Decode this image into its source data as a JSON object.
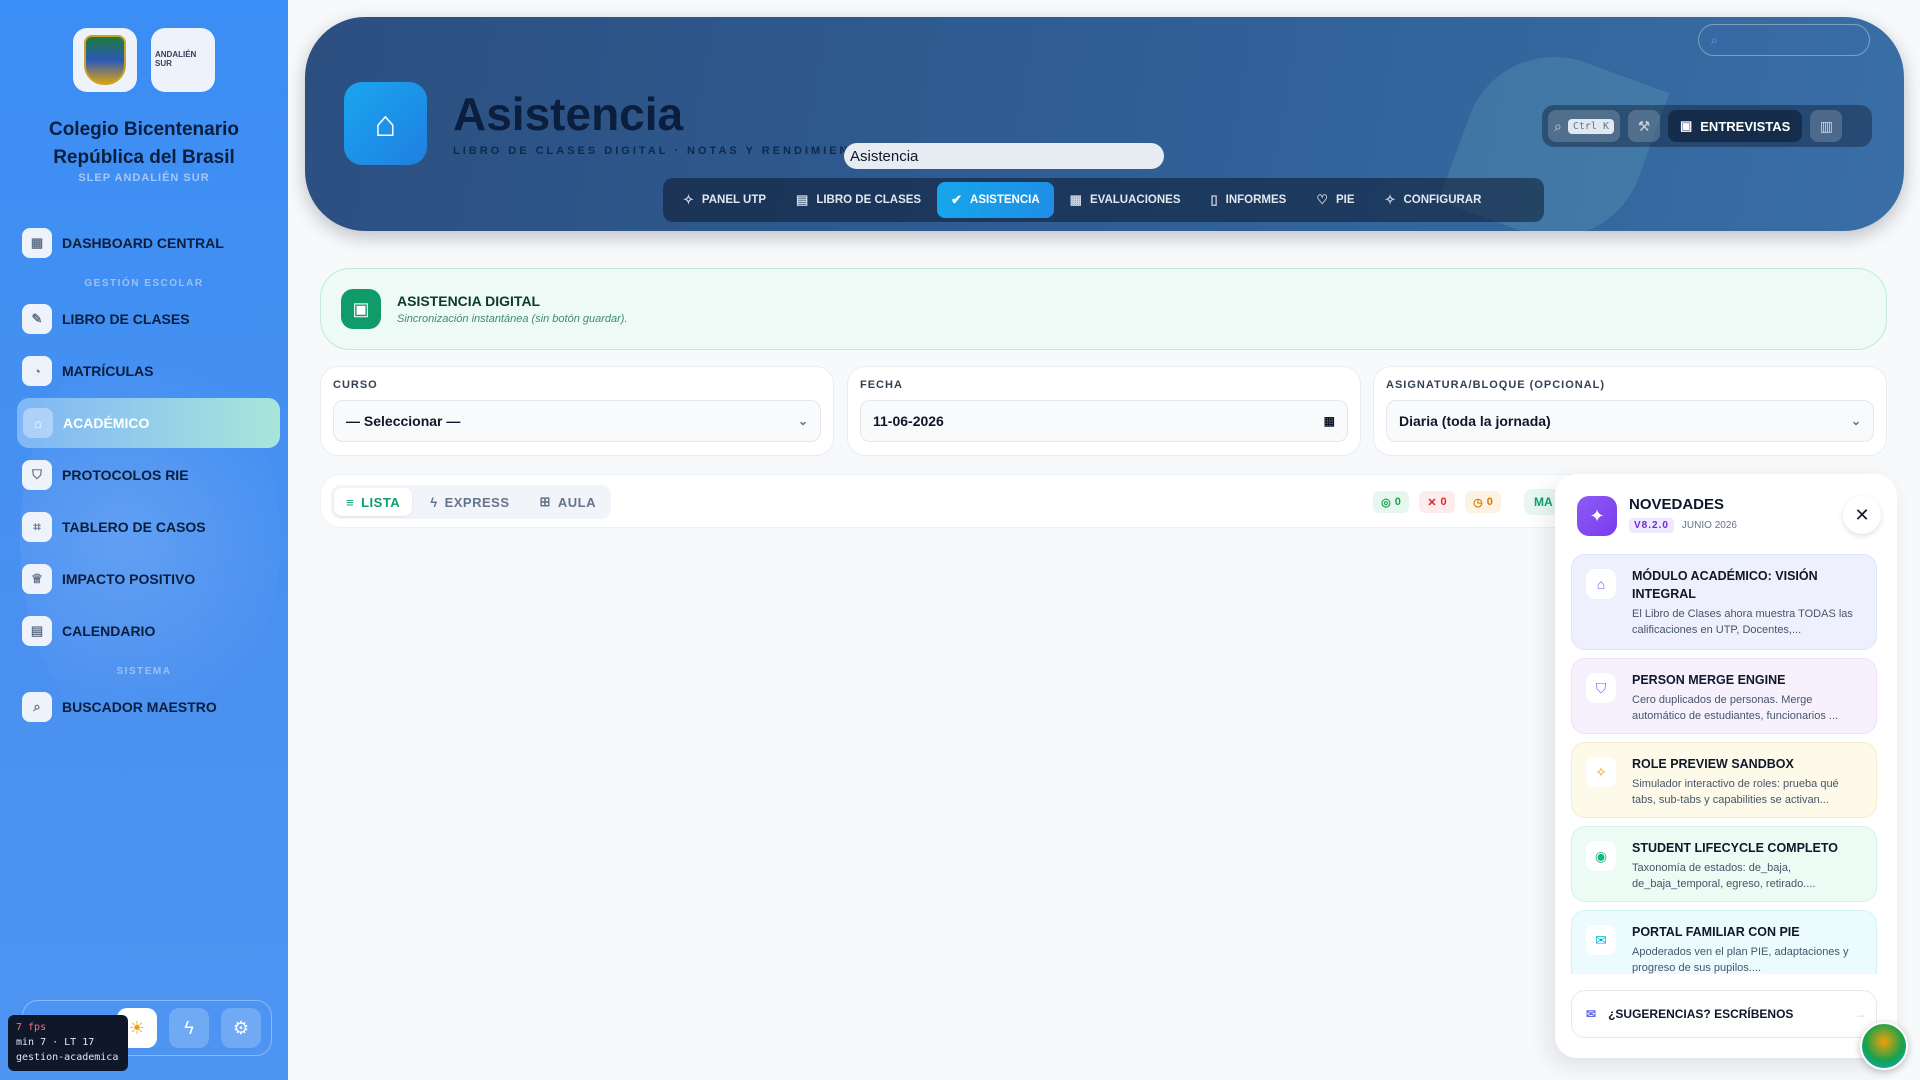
{
  "sidebar": {
    "logo_right_text": "ANDALIÉN SUR",
    "school_name": "Colegio Bicentenario República del Brasil",
    "school_sub": "SLEP ANDALIÉN SUR",
    "dashboard": "DASHBOARD CENTRAL",
    "section_escolar": "GESTIÓN ESCOLAR",
    "items": [
      {
        "label": "LIBRO DE CLASES",
        "icon": "pencil-icon"
      },
      {
        "label": "MATRÍCULAS",
        "icon": "user-icon"
      },
      {
        "label": "ACADÉMICO",
        "icon": "graduation-cap-icon",
        "active": true
      },
      {
        "label": "PROTOCOLOS RIE",
        "icon": "shield-icon"
      },
      {
        "label": "TABLERO DE CASOS",
        "icon": "scan-face-icon"
      },
      {
        "label": "IMPACTO POSITIVO",
        "icon": "trophy-icon"
      },
      {
        "label": "CALENDARIO",
        "icon": "calendar-icon"
      }
    ],
    "section_sistema": "SISTEMA",
    "buscador": "BUSCADOR MAESTRO"
  },
  "fps_overlay": {
    "fps": "7 fps",
    "line2": "min 7 · LT 17",
    "line3": "gestion-academica"
  },
  "header": {
    "title": "Asistencia",
    "subtitle": "LIBRO DE CLASES DIGITAL · NOTAS Y RENDIMIENTO",
    "tooltip_value": "Asistencia",
    "search_kbd": "Ctrl K",
    "entrevistas_label": "ENTREVISTAS",
    "tabs": [
      {
        "label": "PANEL UTP",
        "icon": "sparkles-icon"
      },
      {
        "label": "LIBRO DE CLASES",
        "icon": "clipboard-icon"
      },
      {
        "label": "ASISTENCIA",
        "icon": "check-circle-icon",
        "active": true
      },
      {
        "label": "EVALUACIONES",
        "icon": "calendar-icon"
      },
      {
        "label": "INFORMES",
        "icon": "file-icon"
      },
      {
        "label": "PIE",
        "icon": "heart-icon"
      },
      {
        "label": "CONFIGURAR",
        "icon": "sparkles-icon"
      }
    ]
  },
  "banner": {
    "title": "ASISTENCIA DIGITAL",
    "subtitle": "Sincronización instantánea (sin botón guardar)."
  },
  "filters": {
    "curso_label": "CURSO",
    "curso_value": "— Seleccionar —",
    "fecha_label": "FECHA",
    "fecha_value": "11-06-2026",
    "asignatura_label": "ASIGNATURA/BLOQUE (OPCIONAL)",
    "asignatura_value": "Diaria (toda la jornada)"
  },
  "toolbar": {
    "modes": [
      "LISTA",
      "EXPRESS",
      "AULA"
    ],
    "count_present": "0",
    "count_absent": "0",
    "count_late": "0",
    "ma_label": "MA"
  },
  "novedades": {
    "title": "NOVEDADES",
    "version": "V8.2.0",
    "date": "JUNIO 2026",
    "items": [
      {
        "title": "MÓDULO ACADÉMICO: VISIÓN INTEGRAL",
        "desc": "El Libro de Clases ahora muestra TODAS las calificaciones en UTP, Docentes,...",
        "icon": "graduation-cap-icon"
      },
      {
        "title": "PERSON MERGE ENGINE",
        "desc": "Cero duplicados de personas. Merge automático de estudiantes, funcionarios ...",
        "icon": "shield-check-icon"
      },
      {
        "title": "ROLE PREVIEW SANDBOX",
        "desc": "Simulador interactivo de roles: prueba qué tabs, sub-tabs y capabilities se activan...",
        "icon": "sparkles-icon"
      },
      {
        "title": "STUDENT LIFECYCLE COMPLETO",
        "desc": "Taxonomía de estados: de_baja, de_baja_temporal, egreso, retirado....",
        "icon": "database-icon"
      },
      {
        "title": "PORTAL FAMILIAR CON PIE",
        "desc": "Apoderados ven el plan PIE, adaptaciones y progreso de sus pupilos....",
        "icon": "mail-icon"
      }
    ],
    "suggest": "¿SUGERENCIAS? ESCRÍBENOS"
  },
  "colors": {
    "sidebar": "#3b8ef5",
    "header": "#2f5e95",
    "accent_green": "#109b6b",
    "active_tab": "#16a6ea",
    "novedades_purple": "#7c3aed"
  }
}
